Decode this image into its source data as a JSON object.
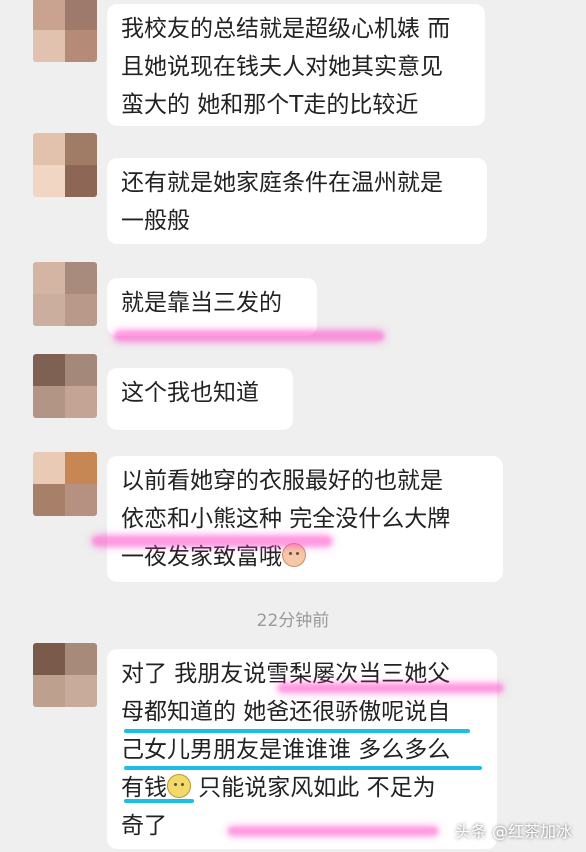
{
  "messages": [
    {
      "lines": [
        "我校友的总结就是超级心机婊 而",
        "且她说现在钱夫人对她其实意见",
        "蛮大的 她和那个T走的比较近"
      ]
    },
    {
      "lines": [
        "还有就是她家庭条件在温州就是",
        "一般般"
      ]
    },
    {
      "lines": [
        "就是靠当三发的"
      ]
    },
    {
      "lines": [
        "这个我也知道"
      ]
    },
    {
      "lines": [
        "以前看她穿的衣服最好的也就是",
        "依恋和小熊这种 完全没什么大牌",
        "一夜发家致富哦"
      ],
      "emoji": "smile-face-emoji"
    },
    {
      "lines": [
        "对了 我朋友说雪梨屡次当三她父",
        "母都知道的 她爸还很骄傲呢说自",
        "己女儿男朋友是谁谁谁 多么多么",
        "有钱",
        "奇了"
      ],
      "line4_rest": " 只能说家风如此 不足为",
      "emoji": "grin-face-emoji"
    }
  ],
  "timestamp": "22分钟前",
  "watermark": "头条 @红茶加冰",
  "colors": {
    "highlight_pink": "#ff46c8",
    "underline_cyan": "#19bfe5",
    "bubble": "#ffffff",
    "background": "#efefef"
  }
}
